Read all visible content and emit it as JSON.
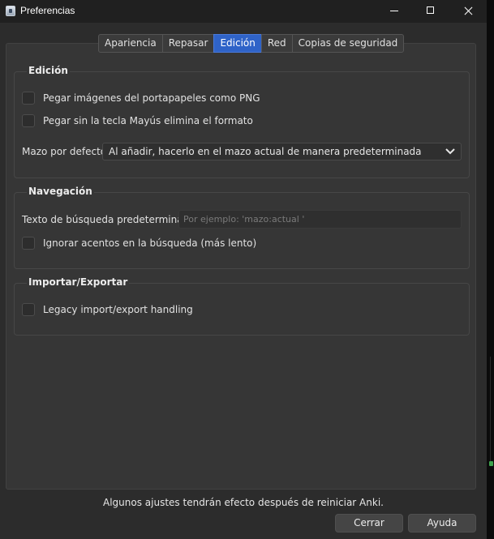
{
  "window": {
    "title": "Preferencias"
  },
  "tabs": [
    {
      "label": "Apariencia",
      "active": false
    },
    {
      "label": "Repasar",
      "active": false
    },
    {
      "label": "Edición",
      "active": true
    },
    {
      "label": "Red",
      "active": false
    },
    {
      "label": "Copias de seguridad",
      "active": false
    }
  ],
  "editing": {
    "title": "Edición",
    "paste_png": {
      "label": "Pegar imágenes del portapapeles como PNG",
      "checked": false
    },
    "paste_strip": {
      "label": "Pegar sin la tecla Mayús elimina el formato",
      "checked": false
    },
    "default_deck_label": "Mazo por defecto",
    "default_deck_value": "Al añadir, hacerlo en el mazo actual de manera predeterminada"
  },
  "browsing": {
    "title": "Navegación",
    "search_label": "Texto de búsqueda predeterminado",
    "search_value": "",
    "search_placeholder": "Por ejemplo: 'mazo:actual '",
    "ignore_accents": {
      "label": "Ignorar acentos en la búsqueda (más lento)",
      "checked": false
    }
  },
  "import_export": {
    "title": "Importar/Exportar",
    "legacy": {
      "label": "Legacy import/export handling",
      "checked": false
    }
  },
  "footer": {
    "note": "Algunos ajustes tendrán efecto después de reiniciar Anki.",
    "close_label": "Cerrar",
    "help_label": "Ayuda"
  },
  "icons": {
    "app": "anki-app-icon",
    "minimize": "minimize-icon",
    "maximize": "maximize-icon",
    "close": "close-icon",
    "dropdown": "chevron-down-icon"
  },
  "colors": {
    "window_bg": "#2c2c2c",
    "titlebar_bg": "#202020",
    "panel_bg": "#363636",
    "active_tab": "#2f63c8",
    "button_bg": "#454545"
  }
}
